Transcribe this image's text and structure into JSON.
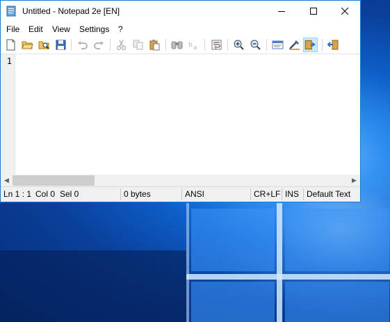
{
  "window": {
    "title": "Untitled - Notepad 2e [EN]"
  },
  "menu": [
    "File",
    "Edit",
    "View",
    "Settings",
    "?"
  ],
  "toolbar": [
    "new-file-icon",
    "open-file-icon",
    "browse-icon",
    "save-icon",
    "undo-icon",
    "redo-icon",
    "cut-icon",
    "copy-icon",
    "paste-icon",
    "find-icon",
    "replace-icon",
    "word-wrap-icon",
    "zoom-in-icon",
    "zoom-out-icon",
    "scheme-icon",
    "customize-icon",
    "exit-icon"
  ],
  "editor": {
    "line_number": "1"
  },
  "status": {
    "position": "Ln 1 : 1",
    "column": "Col 0",
    "selection": "Sel 0",
    "size": "0 bytes",
    "encoding": "ANSI",
    "line_endings": "CR+LF",
    "insert_mode": "INS",
    "scheme": "Default Text"
  },
  "colors": {
    "window_border": "#1979ca",
    "active_tool": "#cce8ff",
    "desktop": "#0d5fc9"
  }
}
